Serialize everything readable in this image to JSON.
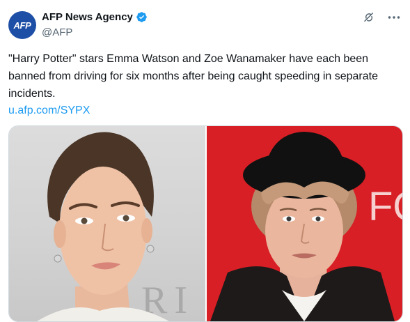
{
  "tweet": {
    "avatar_text": "AFP",
    "display_name": "AFP News Agency",
    "handle": "@AFP",
    "text": "\"Harry Potter\" stars Emma Watson and Zoe Wanamaker have each been banned from driving for six months after being caught speeding in separate incidents.",
    "link": "u.afp.com/SYPX"
  },
  "media": {
    "left_backdrop_text": "RI",
    "right_backdrop_text": "FO"
  },
  "icons": {
    "verified": "verified-badge-icon",
    "grok": "grok-icon",
    "more": "more-icon"
  },
  "colors": {
    "avatar_bg": "#1d4fa6",
    "verified": "#1d9bf0",
    "link": "#1d9bf0",
    "right_bg": "#d81f25"
  }
}
